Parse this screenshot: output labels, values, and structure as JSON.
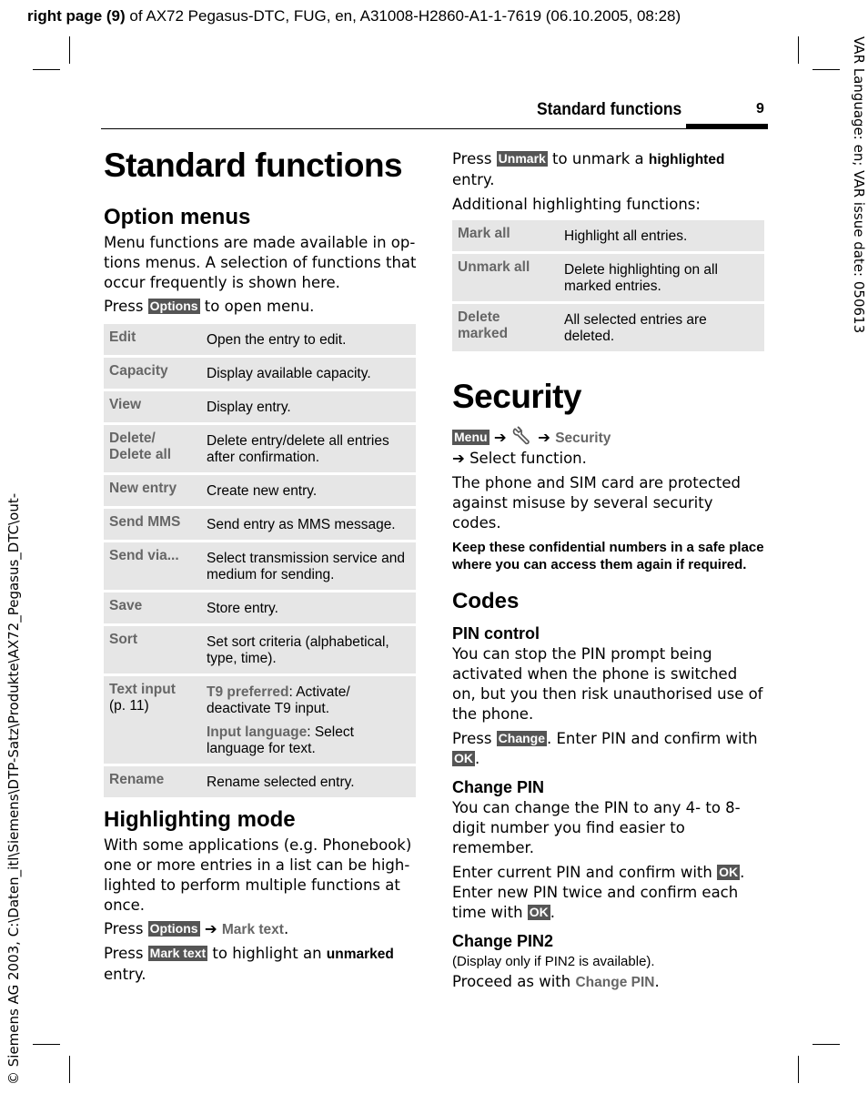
{
  "topline": {
    "bold": "right page (9)",
    "rest": " of AX72 Pegasus-DTC, FUG, en, A31008-H2860-A1-1-7619 (06.10.2005, 08:28)"
  },
  "side_right": "VAR Language: en; VAR issue date: 050613",
  "side_left": "© Siemens AG 2003, C:\\Daten_itl\\Siemens\\DTP-Satz\\Produkte\\AX72_Pegasus_DTC\\out-",
  "header": {
    "title": "Standard functions",
    "page": "9"
  },
  "left": {
    "title": "Standard functions",
    "option_menus": {
      "heading": "Option menus",
      "intro": "Menu functions are made available in op­tions menus. A selection of functions that occur frequently is shown here.",
      "press": "Press ",
      "softkey": "Options",
      "after": " to open menu."
    },
    "table": [
      {
        "key": "Edit",
        "value": "Open the entry to edit."
      },
      {
        "key": "Capacity",
        "value": "Display available capacity."
      },
      {
        "key": "View",
        "value": "Display entry."
      },
      {
        "key": "Delete/\nDelete all",
        "value": "Delete entry/delete all entries after confirmation."
      },
      {
        "key": "New entry",
        "value": "Create new entry."
      },
      {
        "key": "Send MMS",
        "value": "Send entry as MMS message."
      },
      {
        "key": "Send via...",
        "value": "Select transmission service and medium for sending."
      },
      {
        "key": "Save",
        "value": "Store entry."
      },
      {
        "key": "Sort",
        "value": "Set sort criteria (alphabetical, type, time)."
      }
    ],
    "text_input": {
      "key": "Text input",
      "key_note": "(p. 11)",
      "t9_label": "T9 preferred",
      "t9_text": ": Activate/ deactivate T9 input.",
      "lang_label": "Input language",
      "lang_text": ": Select language for text."
    },
    "rename": {
      "key": "Rename",
      "value": "Rename selected entry."
    },
    "highlighting": {
      "heading": "Highlighting mode",
      "intro": "With some applications (e.g. Phonebook) one or more entries in a list can be high­lighted to perform multiple functions at once.",
      "press1": "Press ",
      "softkey1": "Options",
      "arrow": "➔",
      "menu1": "Mark text",
      "dot": ".",
      "press2": "Press ",
      "softkey2": "Mark text",
      "after2": " to highlight an ",
      "bold2": "unmarked",
      "end2": " entry."
    }
  },
  "right": {
    "press": "Press ",
    "softkey": "Unmark",
    "after": " to unmark a ",
    "bold": "highlighted",
    "end": " entry.",
    "additional": "Additional highlighting functions:",
    "table": [
      {
        "key": "Mark all",
        "value": "Highlight all entries."
      },
      {
        "key": "Unmark all",
        "value": "Delete highlighting on all marked entries."
      },
      {
        "key": "Delete\nmarked",
        "value": "All selected entries are deleted."
      }
    ],
    "security": {
      "title": "Security",
      "menu_key": "Menu",
      "arrow": "➔",
      "icon": "wrench-icon",
      "menu_item": "Security",
      "select": "Select function.",
      "intro": "The phone and SIM card are protected against misuse by several security codes.",
      "warning": "Keep these confidential numbers in a safe place where you can access them again if required."
    },
    "codes": {
      "heading": "Codes",
      "pin_control": {
        "heading": "PIN control",
        "text": "You can stop the PIN prompt being activated when the phone is switched on, but you then risk unauthorised use of the phone.",
        "press": "Press ",
        "softkey": "Change",
        "after": ". Enter PIN and confirm with ",
        "ok": "OK",
        "end": "."
      },
      "change_pin": {
        "heading": "Change PIN",
        "text": "You can change the PIN to any 4- to 8-dig­it number you find easier to remember.",
        "text2": "Enter current PIN and confirm with ",
        "ok": "OK",
        "text3": ". Enter new PIN twice and confirm each time with ",
        "ok2": "OK",
        "end": "."
      },
      "change_pin2": {
        "heading": "Change PIN2",
        "note": "(Display only if PIN2 is available).",
        "text": "Proceed as with ",
        "link": "Change PIN",
        "end": "."
      }
    }
  }
}
